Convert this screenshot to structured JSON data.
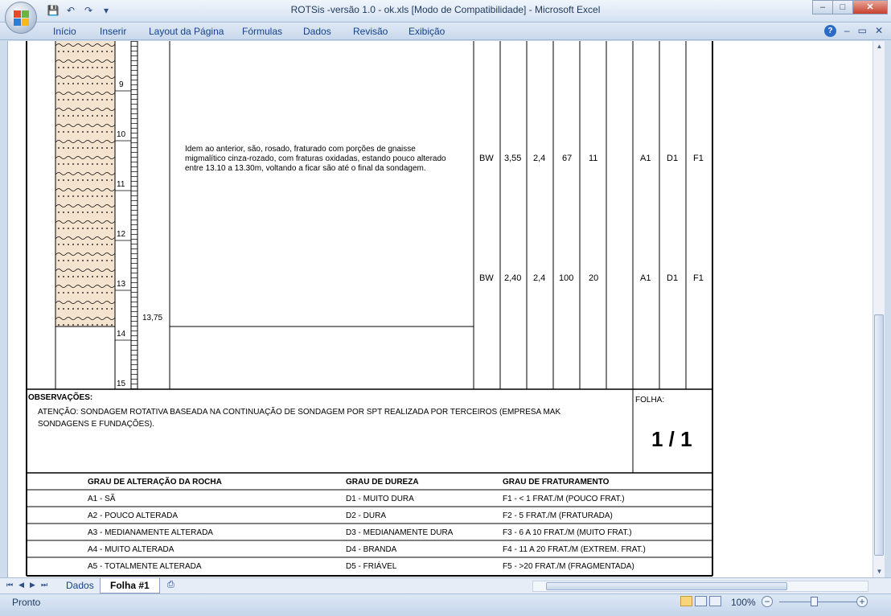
{
  "window": {
    "title": "ROTSis -versão 1.0 - ok.xls  [Modo de Compatibilidade] - Microsoft Excel",
    "minimize": "–",
    "restore": "□",
    "close": "✕"
  },
  "qat": [
    "save-icon",
    "undo-icon",
    "redo-icon",
    "customize-icon"
  ],
  "ribbon": {
    "tabs": [
      "Início",
      "Inserir",
      "Layout da Página",
      "Fórmulas",
      "Dados",
      "Revisão",
      "Exibição"
    ],
    "help": "?",
    "min": "–",
    "restore": "▭",
    "close": "✕"
  },
  "log": {
    "depth_ticks": [
      "9",
      "10",
      "11",
      "12",
      "13",
      "14",
      "15"
    ],
    "end_depth": "13,75",
    "description": [
      "Idem ao anterior, são, rosado, fraturado com porções de gnaisse",
      "migmalítico cinza-rozado, com fraturas oxidadas, estando pouco alterado",
      "entre 13.10 a 13.30m, voltando a ficar são até o final da sondagem."
    ],
    "rows": [
      {
        "diam": "BW",
        "advance": "3,55",
        "recovery": "2,4",
        "pct": "67",
        "rqd": "11",
        "alter": "A1",
        "hard": "D1",
        "frac": "F1"
      },
      {
        "diam": "BW",
        "advance": "2,40",
        "recovery": "2,4",
        "pct": "100",
        "rqd": "20",
        "alter": "A1",
        "hard": "D1",
        "frac": "F1"
      }
    ]
  },
  "observations": {
    "heading": "OBSERVAÇÕES:",
    "line1": "ATENÇÃO: SONDAGEM ROTATIVA BASEADA NA CONTINUAÇÃO DE SONDAGEM POR SPT REALIZADA POR TERCEIROS (EMPRESA MAK",
    "line2": "SONDAGENS E FUNDAÇÕES).",
    "folha_label": "FOLHA:",
    "folha_value": "1 / 1"
  },
  "legend": {
    "headers": [
      "GRAU DE ALTERAÇÃO DA ROCHA",
      "GRAU DE DUREZA",
      "GRAU DE FRATURAMENTO"
    ],
    "rows": [
      [
        "A1 - SÃ",
        "D1 - MUITO DURA",
        "F1 - < 1 FRAT./M (POUCO FRAT.)"
      ],
      [
        "A2 - POUCO ALTERADA",
        "D2 - DURA",
        "F2 - 5 FRAT./M (FRATURADA)"
      ],
      [
        "A3 - MEDIANAMENTE ALTERADA",
        "D3 - MEDIANAMENTE DURA",
        "F3 - 6 A 10 FRAT./M (MUITO FRAT.)"
      ],
      [
        "A4 - MUITO ALTERADA",
        "D4 - BRANDA",
        "F4 - 11 A 20 FRAT./M (EXTREM. FRAT.)"
      ],
      [
        "A5 - TOTALMENTE ALTERADA",
        "D5 - FRIÁVEL",
        "F5 - >20 FRAT./M (FRAGMENTADA)"
      ]
    ]
  },
  "sheet_tabs": [
    "Dados",
    "Folha #1"
  ],
  "nav_arrows": [
    "⏮",
    "◀",
    "▶",
    "⏭"
  ],
  "status": {
    "ready": "Pronto",
    "zoom": "100%",
    "zoom_out": "−",
    "zoom_in": "+"
  },
  "colors": {
    "rock_fill": "#f4e3cf",
    "ribbon_text": "#15428b"
  }
}
